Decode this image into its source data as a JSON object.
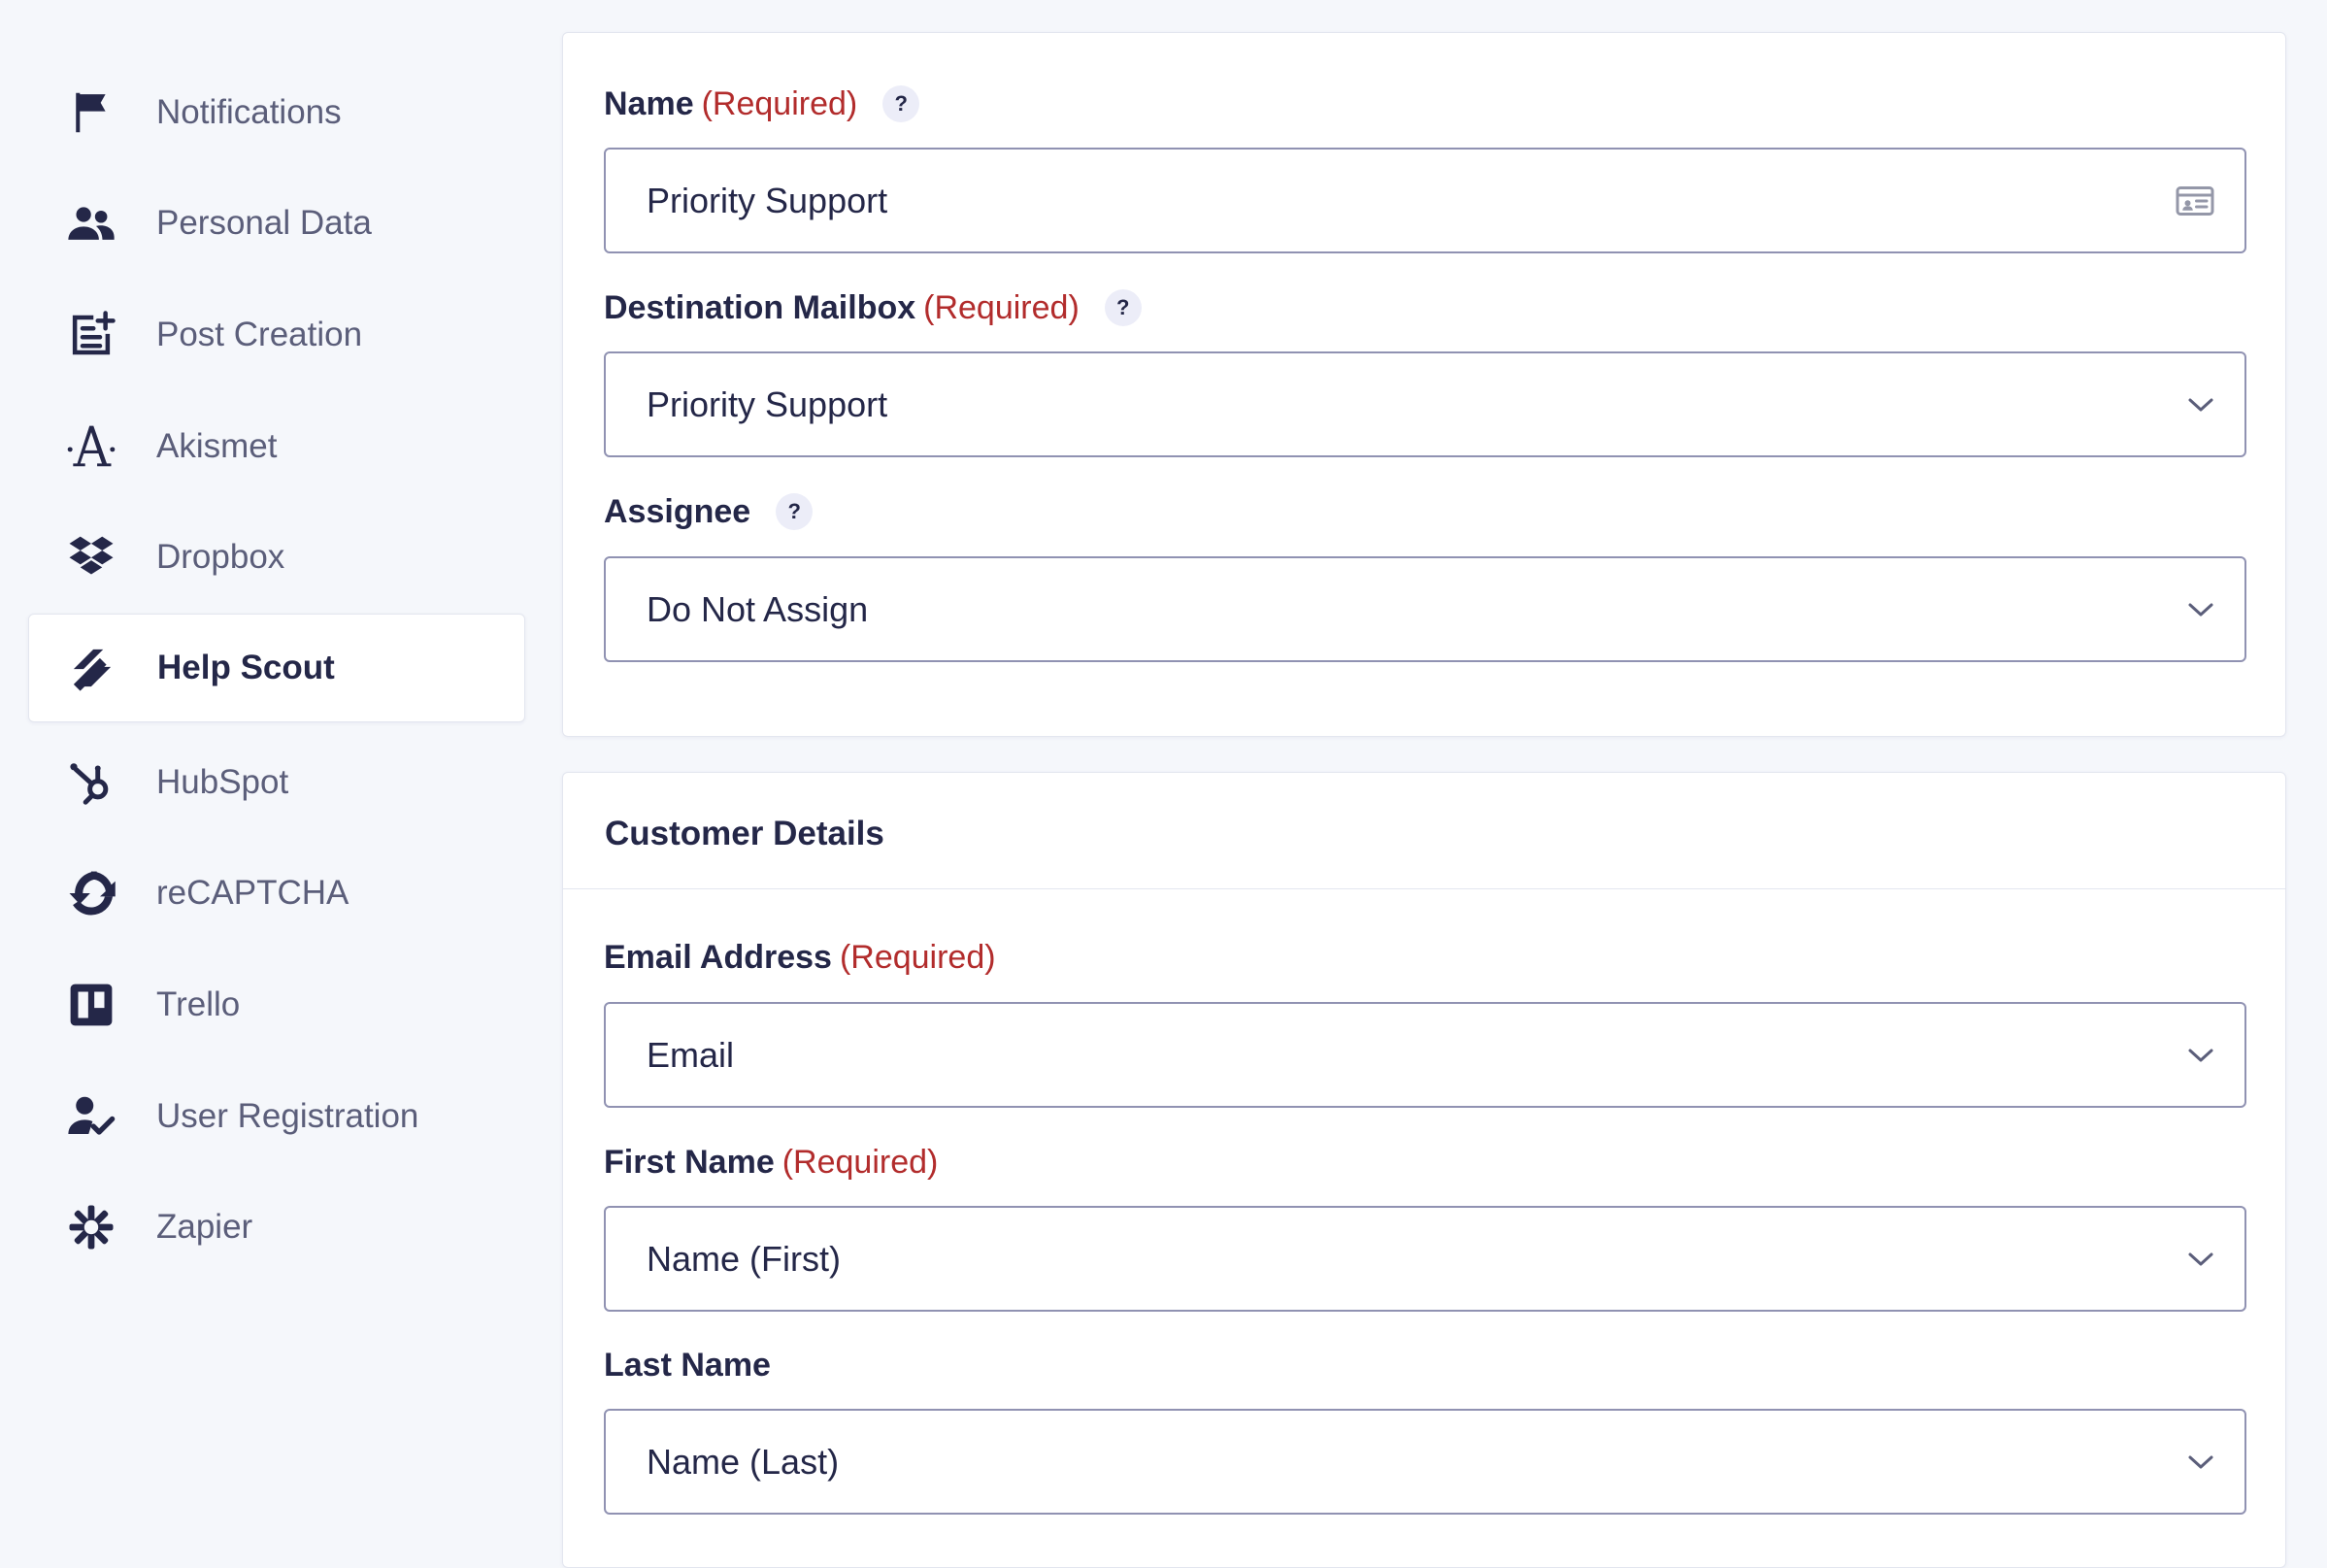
{
  "sidebar": {
    "items": [
      {
        "label": "Notifications",
        "icon": "flag-icon"
      },
      {
        "label": "Personal Data",
        "icon": "users-icon"
      },
      {
        "label": "Post Creation",
        "icon": "post-add-icon"
      },
      {
        "label": "Akismet",
        "icon": "akismet-icon"
      },
      {
        "label": "Dropbox",
        "icon": "dropbox-icon"
      },
      {
        "label": "Help Scout",
        "icon": "helpscout-icon",
        "active": true
      },
      {
        "label": "HubSpot",
        "icon": "hubspot-icon"
      },
      {
        "label": "reCAPTCHA",
        "icon": "recaptcha-icon"
      },
      {
        "label": "Trello",
        "icon": "trello-icon"
      },
      {
        "label": "User Registration",
        "icon": "user-check-icon"
      },
      {
        "label": "Zapier",
        "icon": "zapier-icon"
      }
    ]
  },
  "feed_settings": {
    "name": {
      "label": "Name",
      "required": "(Required)",
      "help": "?",
      "value": "Priority Support"
    },
    "mailbox": {
      "label": "Destination Mailbox",
      "required": "(Required)",
      "help": "?",
      "value": "Priority Support"
    },
    "assignee": {
      "label": "Assignee",
      "help": "?",
      "value": "Do Not Assign"
    }
  },
  "customer_details": {
    "title": "Customer Details",
    "email": {
      "label": "Email Address",
      "required": "(Required)",
      "value": "Email"
    },
    "first_name": {
      "label": "First Name",
      "required": "(Required)",
      "value": "Name (First)"
    },
    "last_name": {
      "label": "Last Name",
      "value": "Name (Last)"
    }
  },
  "colors": {
    "text": "#242748",
    "muted_text": "#5b5e7a",
    "required": "#b22c2c",
    "border": "#9092b2",
    "background": "#f5f7fb"
  }
}
